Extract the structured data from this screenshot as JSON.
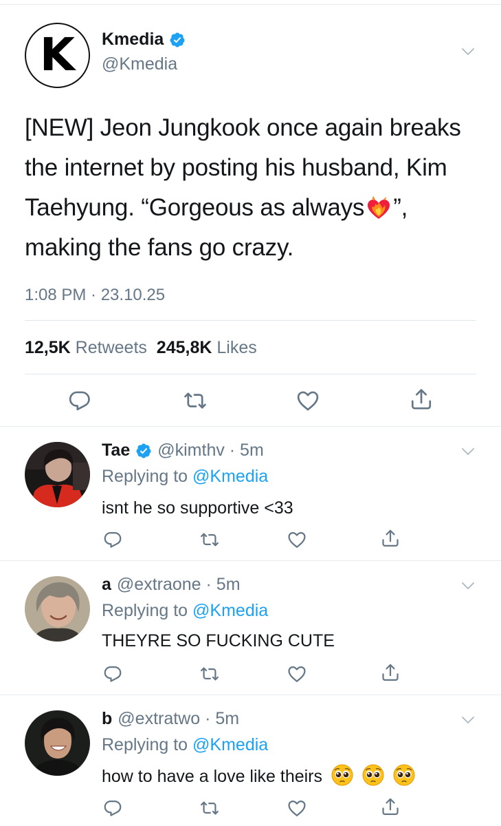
{
  "main_tweet": {
    "avatar_letter": "K",
    "display_name": "Kmedia",
    "handle": "@Kmedia",
    "text_part1": "[NEW] Jeon Jungkook once again breaks the internet by posting his husband, Kim Taehyung. “Gorgeous as always",
    "text_part2": "”, making the fans go crazy.",
    "emoji": "heart-on-fire",
    "timestamp": "1:08 PM · 23.10.25",
    "retweets_count": "12,5K",
    "retweets_label": "Retweets",
    "likes_count": "245,8K",
    "likes_label": "Likes"
  },
  "replies": [
    {
      "display_name": "Tae",
      "verified": true,
      "handle_time": "@kimthv · 5m",
      "replying_label": "Replying to",
      "replying_to": "@Kmedia",
      "text": "isnt he so supportive <33"
    },
    {
      "display_name": "a",
      "verified": false,
      "handle_time": "@extraone · 5m",
      "replying_label": "Replying to",
      "replying_to": "@Kmedia",
      "text": "THEYRE SO FUCKING CUTE"
    },
    {
      "display_name": "b",
      "verified": false,
      "handle_time": "@extratwo · 5m",
      "replying_label": "Replying to",
      "replying_to": "@Kmedia",
      "text": "how to have a love like theirs",
      "emoji": [
        "pleading-face",
        "pleading-face",
        "pleading-face"
      ]
    }
  ],
  "colors": {
    "accent": "#1da1f2",
    "secondary_text": "#657786",
    "primary_text": "#14171a",
    "divider": "#e6ecf0"
  }
}
